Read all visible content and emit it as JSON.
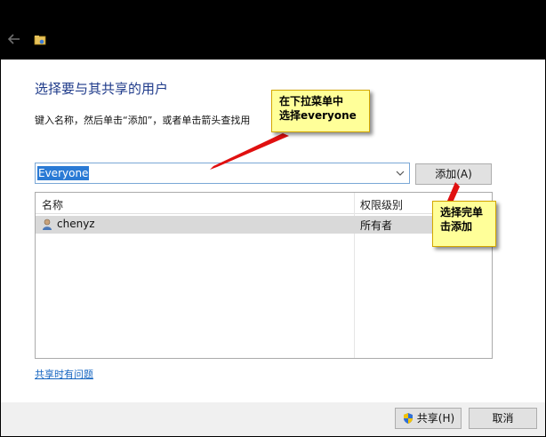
{
  "dialog": {
    "heading": "选择要与其共享的用户",
    "instruction": "键入名称，然后单击“添加”，或者单击箭头查找用"
  },
  "user_combo": {
    "value": "Everyone"
  },
  "buttons": {
    "add_label": "添加(A)",
    "share_label": "共享(H)",
    "cancel_label": "取消"
  },
  "list": {
    "columns": [
      "名称",
      "权限级别"
    ],
    "rows": [
      {
        "name": "chenyz",
        "permission": "所有者"
      }
    ]
  },
  "help_link": "共享时有问题",
  "callouts": {
    "first": [
      "在下拉菜单中",
      "选择everyone"
    ],
    "second": [
      "选择完单",
      "击添加"
    ]
  },
  "colors": {
    "accent": "#2a7ad5",
    "heading": "#1e3a8a",
    "callout_bg": "#ffff99",
    "arrow": "#e01010"
  },
  "icons": {
    "back": "back-arrow-icon",
    "app": "share-folder-icon",
    "dropdown": "chevron-down-icon",
    "user": "user-icon",
    "uac": "uac-shield-icon"
  }
}
